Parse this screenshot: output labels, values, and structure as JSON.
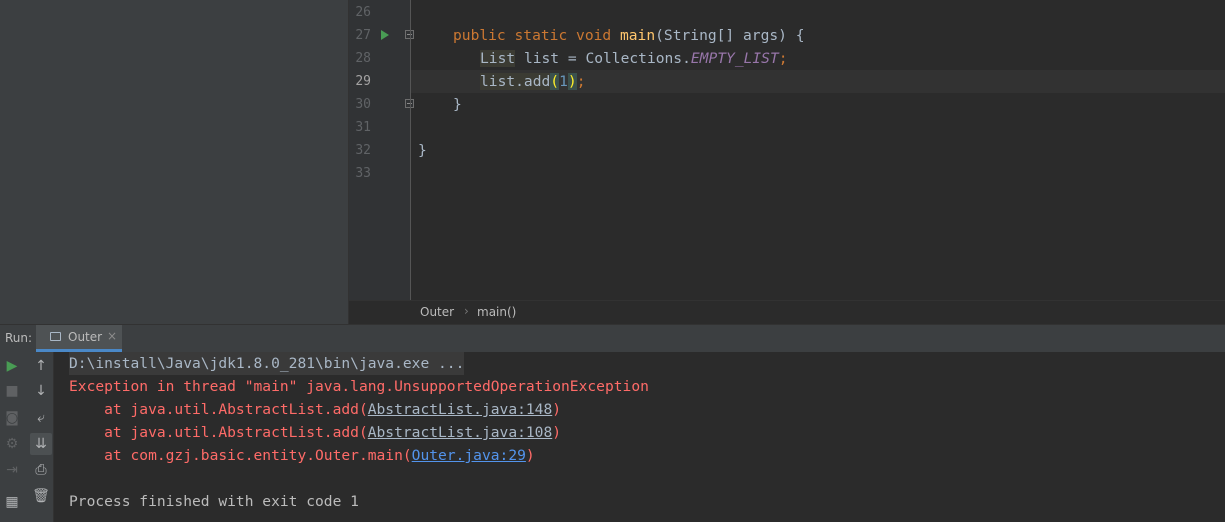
{
  "editor": {
    "line_numbers": [
      "26",
      "27",
      "28",
      "29",
      "30",
      "31",
      "32",
      "33"
    ],
    "code": {
      "l27": {
        "kw1": "public",
        "kw2": "static",
        "kw3": "void",
        "method": "main",
        "params": "(String[] args) {"
      },
      "l28": {
        "type": "List",
        "rest": " list = Collections.",
        "const": "EMPTY_LIST",
        "semi": ";"
      },
      "l29": {
        "call": "list.add",
        "open": "(",
        "num": "1",
        "close": ")",
        "semi": ";"
      },
      "l30": "}",
      "l32": "}"
    }
  },
  "breadcrumb": {
    "class": "Outer",
    "separator": "›",
    "method": "main()"
  },
  "run": {
    "label": "Run:",
    "tab_label": "Outer",
    "tab_close": "×"
  },
  "toolbar": {
    "rerun": "▶",
    "stop": "■",
    "up": "↑",
    "down": "↓",
    "camera": "◙",
    "wrap": "⤶",
    "settings": "⚙",
    "scroll_end": "⇊",
    "login": "⇥",
    "print": "⎙",
    "layout": "▦",
    "trash": "🗑"
  },
  "console": {
    "cmd": "D:\\install\\Java\\jdk1.8.0_281\\bin\\java.exe ...",
    "exception": "Exception in thread \"main\" java.lang.UnsupportedOperationException",
    "frames": [
      {
        "prefix": "    at java.util.AbstractList.add(",
        "link": "AbstractList.java:148",
        "suffix": ")"
      },
      {
        "prefix": "    at java.util.AbstractList.add(",
        "link": "AbstractList.java:108",
        "suffix": ")"
      },
      {
        "prefix": "    at com.gzj.basic.entity.Outer.main(",
        "link": "Outer.java:29",
        "suffix": ")"
      }
    ],
    "exit": "Process finished with exit code 1"
  },
  "colors": {
    "editor_bg": "#2b2b2b",
    "panel_bg": "#3c3f41",
    "keyword": "#cc7832",
    "method": "#ffc66d",
    "error": "#ff6b68",
    "link_blue": "#5394ec"
  }
}
